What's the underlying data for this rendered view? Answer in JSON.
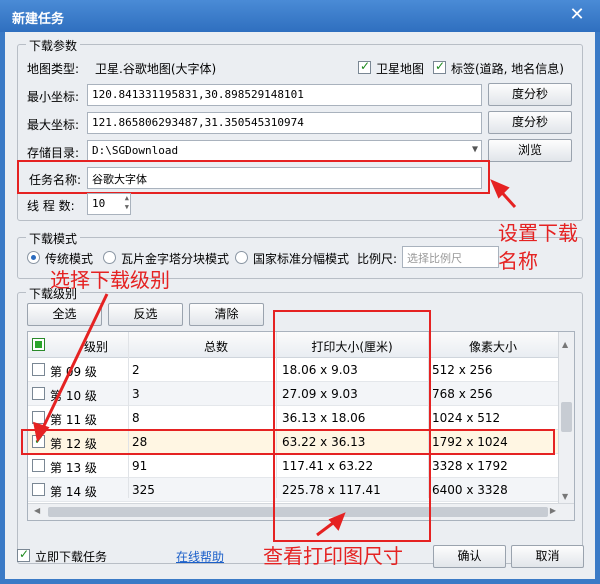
{
  "window": {
    "title": "新建任务",
    "close": "✕"
  },
  "params": {
    "legend": "下载参数",
    "map_type_label": "地图类型:",
    "map_type_value": "卫星.谷歌地图(大字体)",
    "satellite_label": "卫星地图",
    "label_label": "标签(道路, 地名信息)",
    "min_label": "最小坐标:",
    "min_value": "120.841331195831,30.898529148101",
    "max_label": "最大坐标:",
    "max_value": "121.865806293487,31.350545310974",
    "dms_button": "度分秒",
    "dir_label": "存储目录:",
    "dir_value": "D:\\SGDownload",
    "browse_button": "浏览",
    "task_label": "任务名称:",
    "task_value": "谷歌大字体",
    "threads_label": "线 程 数:",
    "threads_value": "10"
  },
  "mode": {
    "legend": "下载模式",
    "opt1": "传统模式",
    "opt2": "瓦片金字塔分块模式",
    "opt3": "国家标准分幅模式",
    "scale_label": "比例尺:",
    "scale_placeholder": "选择比例尺"
  },
  "levels": {
    "legend": "下载级别",
    "select_all": "全选",
    "invert": "反选",
    "clear": "清除",
    "headers": [
      "级别",
      "总数",
      "打印大小(厘米)",
      "像素大小"
    ],
    "rows": [
      {
        "level": "第 09 级",
        "total": "2",
        "print": "18.06 x 9.03",
        "pixel": "512 x 256",
        "checked": false
      },
      {
        "level": "第 10 级",
        "total": "3",
        "print": "27.09 x 9.03",
        "pixel": "768 x 256",
        "checked": false
      },
      {
        "level": "第 11 级",
        "total": "8",
        "print": "36.13 x 18.06",
        "pixel": "1024 x 512",
        "checked": false
      },
      {
        "level": "第 12 级",
        "total": "28",
        "print": "63.22 x 36.13",
        "pixel": "1792 x 1024",
        "checked": true
      },
      {
        "level": "第 13 级",
        "total": "91",
        "print": "117.41 x 63.22",
        "pixel": "3328 x 1792",
        "checked": false
      },
      {
        "level": "第 14 级",
        "total": "325",
        "print": "225.78 x 117.41",
        "pixel": "6400 x 3328",
        "checked": false
      }
    ]
  },
  "footer": {
    "immediate": "立即下载任务",
    "help": "在线帮助",
    "ok": "确认",
    "cancel": "取消"
  },
  "notes": {
    "set_name": "设置下载",
    "set_name2": "名称",
    "select_level": "选择下载级别",
    "view_print": "查看打印图尺寸"
  }
}
